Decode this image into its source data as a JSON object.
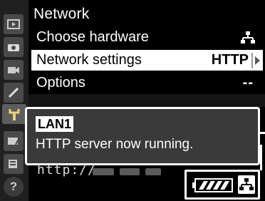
{
  "header": {
    "title": "Network"
  },
  "menu": {
    "items": [
      {
        "label": "Choose hardware",
        "value_icon": "network-icon"
      },
      {
        "label": "Network settings",
        "value": "HTTP",
        "selected": true
      },
      {
        "label": "Options",
        "value": "--"
      }
    ]
  },
  "status": {
    "tag": "LAN1",
    "message": "HTTP server now running.",
    "url": "http://"
  },
  "tabs": [
    "playback-icon",
    "camera-icon",
    "movie-icon",
    "pencil-icon",
    "wrench-icon",
    "retouch-icon",
    "mymenu-icon",
    "help-icon"
  ],
  "indicators": {
    "battery": "battery-full-icon",
    "network": "network-icon"
  },
  "colors": {
    "selected_row": "#ffffff",
    "panel": "#3a3a3a",
    "tab_strip": "#202020"
  }
}
